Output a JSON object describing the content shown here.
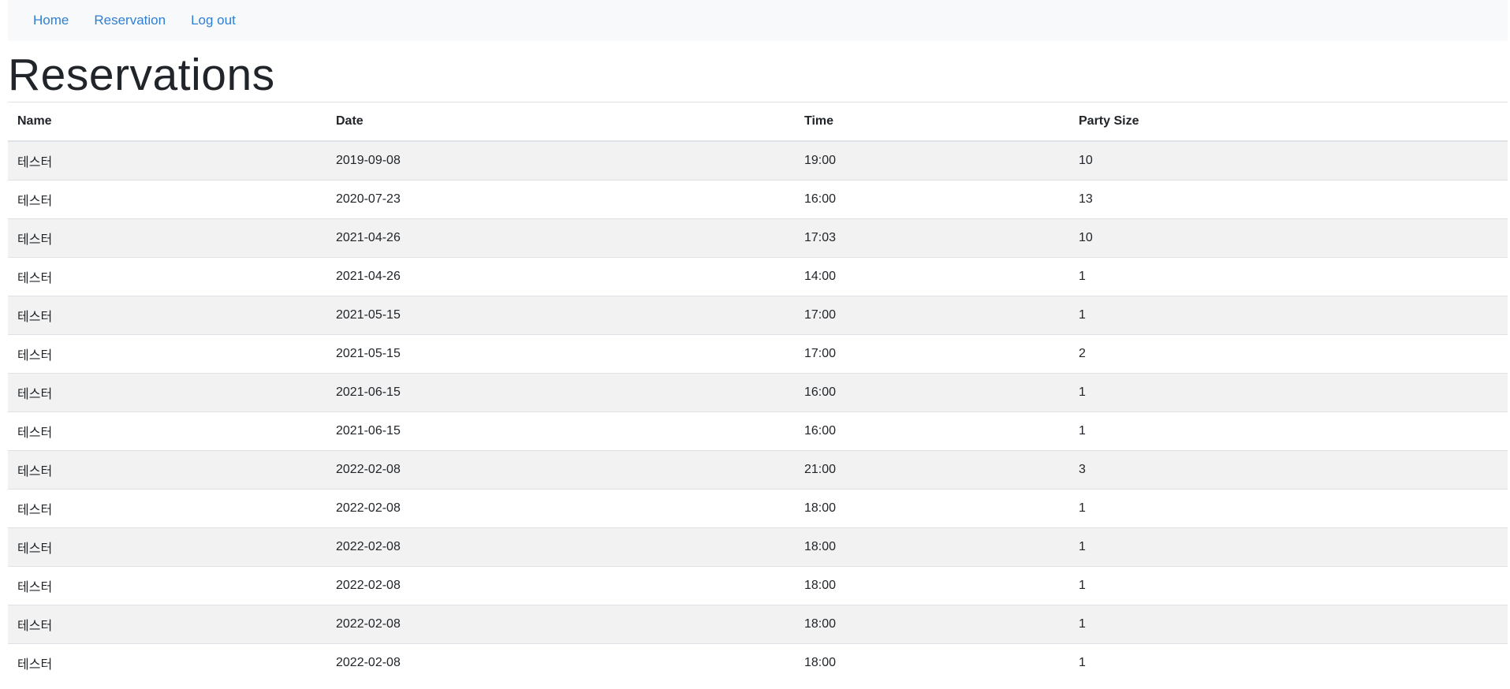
{
  "nav": {
    "items": [
      {
        "label": "Home"
      },
      {
        "label": "Reservation"
      },
      {
        "label": "Log out"
      }
    ]
  },
  "page": {
    "title": "Reservations"
  },
  "table": {
    "headers": {
      "name": "Name",
      "date": "Date",
      "time": "Time",
      "party_size": "Party Size"
    },
    "rows": [
      {
        "name": "테스터",
        "date": "2019-09-08",
        "time": "19:00",
        "party_size": "10"
      },
      {
        "name": "테스터",
        "date": "2020-07-23",
        "time": "16:00",
        "party_size": "13"
      },
      {
        "name": "테스터",
        "date": "2021-04-26",
        "time": "17:03",
        "party_size": "10"
      },
      {
        "name": "테스터",
        "date": "2021-04-26",
        "time": "14:00",
        "party_size": "1"
      },
      {
        "name": "테스터",
        "date": "2021-05-15",
        "time": "17:00",
        "party_size": "1"
      },
      {
        "name": "테스터",
        "date": "2021-05-15",
        "time": "17:00",
        "party_size": "2"
      },
      {
        "name": "테스터",
        "date": "2021-06-15",
        "time": "16:00",
        "party_size": "1"
      },
      {
        "name": "테스터",
        "date": "2021-06-15",
        "time": "16:00",
        "party_size": "1"
      },
      {
        "name": "테스터",
        "date": "2022-02-08",
        "time": "21:00",
        "party_size": "3"
      },
      {
        "name": "테스터",
        "date": "2022-02-08",
        "time": "18:00",
        "party_size": "1"
      },
      {
        "name": "테스터",
        "date": "2022-02-08",
        "time": "18:00",
        "party_size": "1"
      },
      {
        "name": "테스터",
        "date": "2022-02-08",
        "time": "18:00",
        "party_size": "1"
      },
      {
        "name": "테스터",
        "date": "2022-02-08",
        "time": "18:00",
        "party_size": "1"
      },
      {
        "name": "테스터",
        "date": "2022-02-08",
        "time": "18:00",
        "party_size": "1"
      }
    ]
  },
  "colors": {
    "link": "#2f7fd4",
    "navbar_bg": "#f8f9fa",
    "stripe": "#f2f2f2",
    "border": "#dee2e6",
    "text": "#212529"
  }
}
